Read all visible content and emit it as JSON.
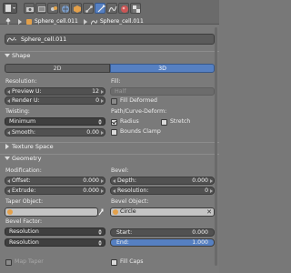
{
  "breadcrumb": {
    "item1": "Sphere_cell.011",
    "item2": "Sphere_cell.011"
  },
  "datablock": {
    "name": "Sphere_cell.011"
  },
  "shape": {
    "title": "Shape",
    "tab_2d": "2D",
    "tab_3d": "3D",
    "resolution_label": "Resolution:",
    "preview_u_label": "Preview U:",
    "preview_u_value": "12",
    "render_u_label": "Render U:",
    "render_u_value": "0",
    "fill_label": "Fill:",
    "fill_value": "Half",
    "fill_deformed_label": "Fill Deformed",
    "twisting_label": "Twisting:",
    "twisting_value": "Minimum",
    "smooth_label": "Smooth:",
    "smooth_value": "0.00",
    "path_deform_label": "Path/Curve-Deform:",
    "radius_label": "Radius",
    "stretch_label": "Stretch",
    "bounds_clamp_label": "Bounds Clamp"
  },
  "texture_space": {
    "title": "Texture Space"
  },
  "geometry": {
    "title": "Geometry",
    "modification_label": "Modification:",
    "offset_label": "Offset:",
    "offset_value": "0.000",
    "extrude_label": "Extrude:",
    "extrude_value": "0.000",
    "bevel_label": "Bevel:",
    "depth_label": "Depth:",
    "depth_value": "0.000",
    "resolution_label": "Resolution:",
    "resolution_value": "0",
    "taper_label": "Taper Object:",
    "bevel_object_label": "Bevel Object:",
    "bevel_object_value": "Circle",
    "bevel_factor_label": "Bevel Factor:",
    "bf_mode1": "Resolution",
    "bf_mode2": "Resolution",
    "start_label": "Start:",
    "start_value": "0.000",
    "end_label": "End:",
    "end_value": "1.000",
    "map_taper_label": "Map Taper",
    "fill_caps_label": "Fill Caps"
  },
  "colors": {
    "accent": "#5680c2",
    "panel": "#7a7a7a",
    "field": "#515151"
  }
}
